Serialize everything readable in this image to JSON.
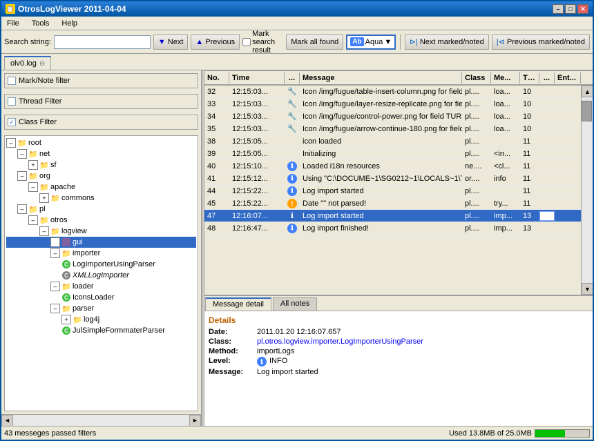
{
  "window": {
    "title": "OtrosLogViewer 2011-04-04",
    "min_btn": "–",
    "max_btn": "□",
    "close_btn": "✕"
  },
  "menu": {
    "items": [
      "File",
      "Tools",
      "Help"
    ]
  },
  "toolbar": {
    "search_label": "Search string:",
    "search_placeholder": "",
    "next_btn": "Next",
    "prev_btn": "Previous",
    "mark_search_btn": "Mark search result",
    "mark_all_btn": "Mark all found",
    "aqua_label": "Aqua",
    "next_marked_btn": "Next marked/noted",
    "prev_marked_btn": "Previous marked/noted"
  },
  "tabs": {
    "items": [
      {
        "label": "olv0.log",
        "active": true
      }
    ]
  },
  "sidebar": {
    "mark_note_label": "Mark/Note filter",
    "thread_filter_label": "Thread Filter",
    "class_filter_label": "Class Filter",
    "tree": [
      {
        "id": "root",
        "label": "root",
        "level": 0,
        "expanded": true,
        "type": "folder"
      },
      {
        "id": "net",
        "label": "net",
        "level": 1,
        "expanded": true,
        "type": "folder"
      },
      {
        "id": "sf",
        "label": "sf",
        "level": 2,
        "expanded": false,
        "type": "folder"
      },
      {
        "id": "org",
        "label": "org",
        "level": 1,
        "expanded": true,
        "type": "folder"
      },
      {
        "id": "apache",
        "label": "apache",
        "level": 2,
        "expanded": true,
        "type": "folder"
      },
      {
        "id": "commons",
        "label": "commons",
        "level": 3,
        "expanded": false,
        "type": "folder"
      },
      {
        "id": "pl",
        "label": "pl",
        "level": 1,
        "expanded": true,
        "type": "folder"
      },
      {
        "id": "otros",
        "label": "otros",
        "level": 2,
        "expanded": true,
        "type": "folder"
      },
      {
        "id": "logview",
        "label": "logview",
        "level": 3,
        "expanded": true,
        "type": "folder"
      },
      {
        "id": "gui",
        "label": "gui",
        "level": 4,
        "expanded": true,
        "type": "package",
        "selected": true
      },
      {
        "id": "importer",
        "label": "importer",
        "level": 4,
        "expanded": true,
        "type": "folder"
      },
      {
        "id": "LogImporterUsingParser",
        "label": "LogImporterUsingParser",
        "level": 5,
        "type": "class-green"
      },
      {
        "id": "XMLLogImporter",
        "label": "XMLLogImporter",
        "level": 5,
        "type": "class-gray"
      },
      {
        "id": "loader",
        "label": "loader",
        "level": 4,
        "expanded": true,
        "type": "folder"
      },
      {
        "id": "IconsLoader",
        "label": "IconsLoader",
        "level": 5,
        "type": "class-green"
      },
      {
        "id": "parser",
        "label": "parser",
        "level": 4,
        "expanded": true,
        "type": "folder"
      },
      {
        "id": "log4j",
        "label": "log4j",
        "level": 5,
        "expanded": false,
        "type": "folder"
      },
      {
        "id": "JulSimpleFormmaterParser",
        "label": "JulSimpleFormmaterParser",
        "level": 5,
        "type": "class-green"
      }
    ]
  },
  "table": {
    "columns": [
      "No.",
      "Time",
      "...",
      "Message",
      "Class",
      "Me...",
      "Th...",
      "...",
      "Ent..."
    ],
    "rows": [
      {
        "no": "32",
        "time": "12:15:03...",
        "dots": "🔧",
        "msg": "Icon /img/fugue/table-insert-column.png for field ...",
        "class": "pl....",
        "me": "loa...",
        "th": "10",
        "dots2": "",
        "ent": ""
      },
      {
        "no": "33",
        "time": "12:15:03...",
        "dots": "🔧",
        "msg": "Icon /img/fugue/layer-resize-replicate.png for fie...",
        "class": "pl....",
        "me": "loa...",
        "th": "10",
        "dots2": "",
        "ent": ""
      },
      {
        "no": "34",
        "time": "12:15:03...",
        "dots": "🔧",
        "msg": "Icon /img/fugue/control-power.png for field TURN...",
        "class": "pl....",
        "me": "loa...",
        "th": "10",
        "dots2": "",
        "ent": ""
      },
      {
        "no": "35",
        "time": "12:15:03...",
        "dots": "🔧",
        "msg": "Icon /img/fugue/arrow-continue-180.png for field ...",
        "class": "pl....",
        "me": "loa...",
        "th": "10",
        "dots2": "",
        "ent": ""
      },
      {
        "no": "38",
        "time": "12:15:05...",
        "dots": "",
        "msg": "icon loaded",
        "class": "pl....",
        "me": "",
        "th": "11",
        "dots2": "",
        "ent": ""
      },
      {
        "no": "39",
        "time": "12:15:05...",
        "dots": "",
        "msg": "Initializing",
        "class": "pl....",
        "me": "<in...",
        "th": "11",
        "dots2": "",
        "ent": ""
      },
      {
        "no": "40",
        "time": "12:15:10...",
        "dots": "ℹ",
        "msg": "Loaded i18n resources",
        "class": "ne....",
        "me": "<cl...",
        "th": "11",
        "dots2": "",
        "ent": ""
      },
      {
        "no": "41",
        "time": "12:15:12...",
        "dots": "ℹ",
        "msg": "Using \"C:\\DOCUME~1\\SG0212~1\\LOCALS~1\\Tem...",
        "class": "or....",
        "me": "info",
        "th": "11",
        "dots2": "",
        "ent": ""
      },
      {
        "no": "44",
        "time": "12:15:22...",
        "dots": "ℹ",
        "msg": "Log import started",
        "class": "pl....",
        "me": "",
        "th": "11",
        "dots2": "",
        "ent": ""
      },
      {
        "no": "45",
        "time": "12:15:22...",
        "dots": "⚠",
        "msg": "Date \"\" not parsed!",
        "class": "pl....",
        "me": "try...",
        "th": "11",
        "dots2": "",
        "ent": ""
      },
      {
        "no": "47",
        "time": "12:16:07...",
        "dots": "ℹ",
        "msg": "Log import started",
        "class": "pl....",
        "me": "imp...",
        "th": "13",
        "dots2": "",
        "ent": "",
        "selected": true
      },
      {
        "no": "48",
        "time": "12:16:47...",
        "dots": "ℹ",
        "msg": "Log import finished!",
        "class": "pl....",
        "me": "imp...",
        "th": "13",
        "dots2": "",
        "ent": ""
      }
    ]
  },
  "detail": {
    "tabs": [
      "Message detail",
      "All notes"
    ],
    "active_tab": "Message detail",
    "title": "Details",
    "date_label": "Date:",
    "date_val": "2011.01.20 12:16:07.657",
    "class_label": "Class:",
    "class_val": "pl.otros.logview.importer.LogImporterUsingParser",
    "method_label": "Method:",
    "method_val": "importLogs",
    "level_label": "Level:",
    "level_icon": "ℹ",
    "level_val": "INFO",
    "message_label": "Message:",
    "message_val": "Log import started"
  },
  "status": {
    "text": "43 messeges passed filters",
    "mem_used": "Used 13.8MB of 25.0MB",
    "mem_percent": 55
  }
}
